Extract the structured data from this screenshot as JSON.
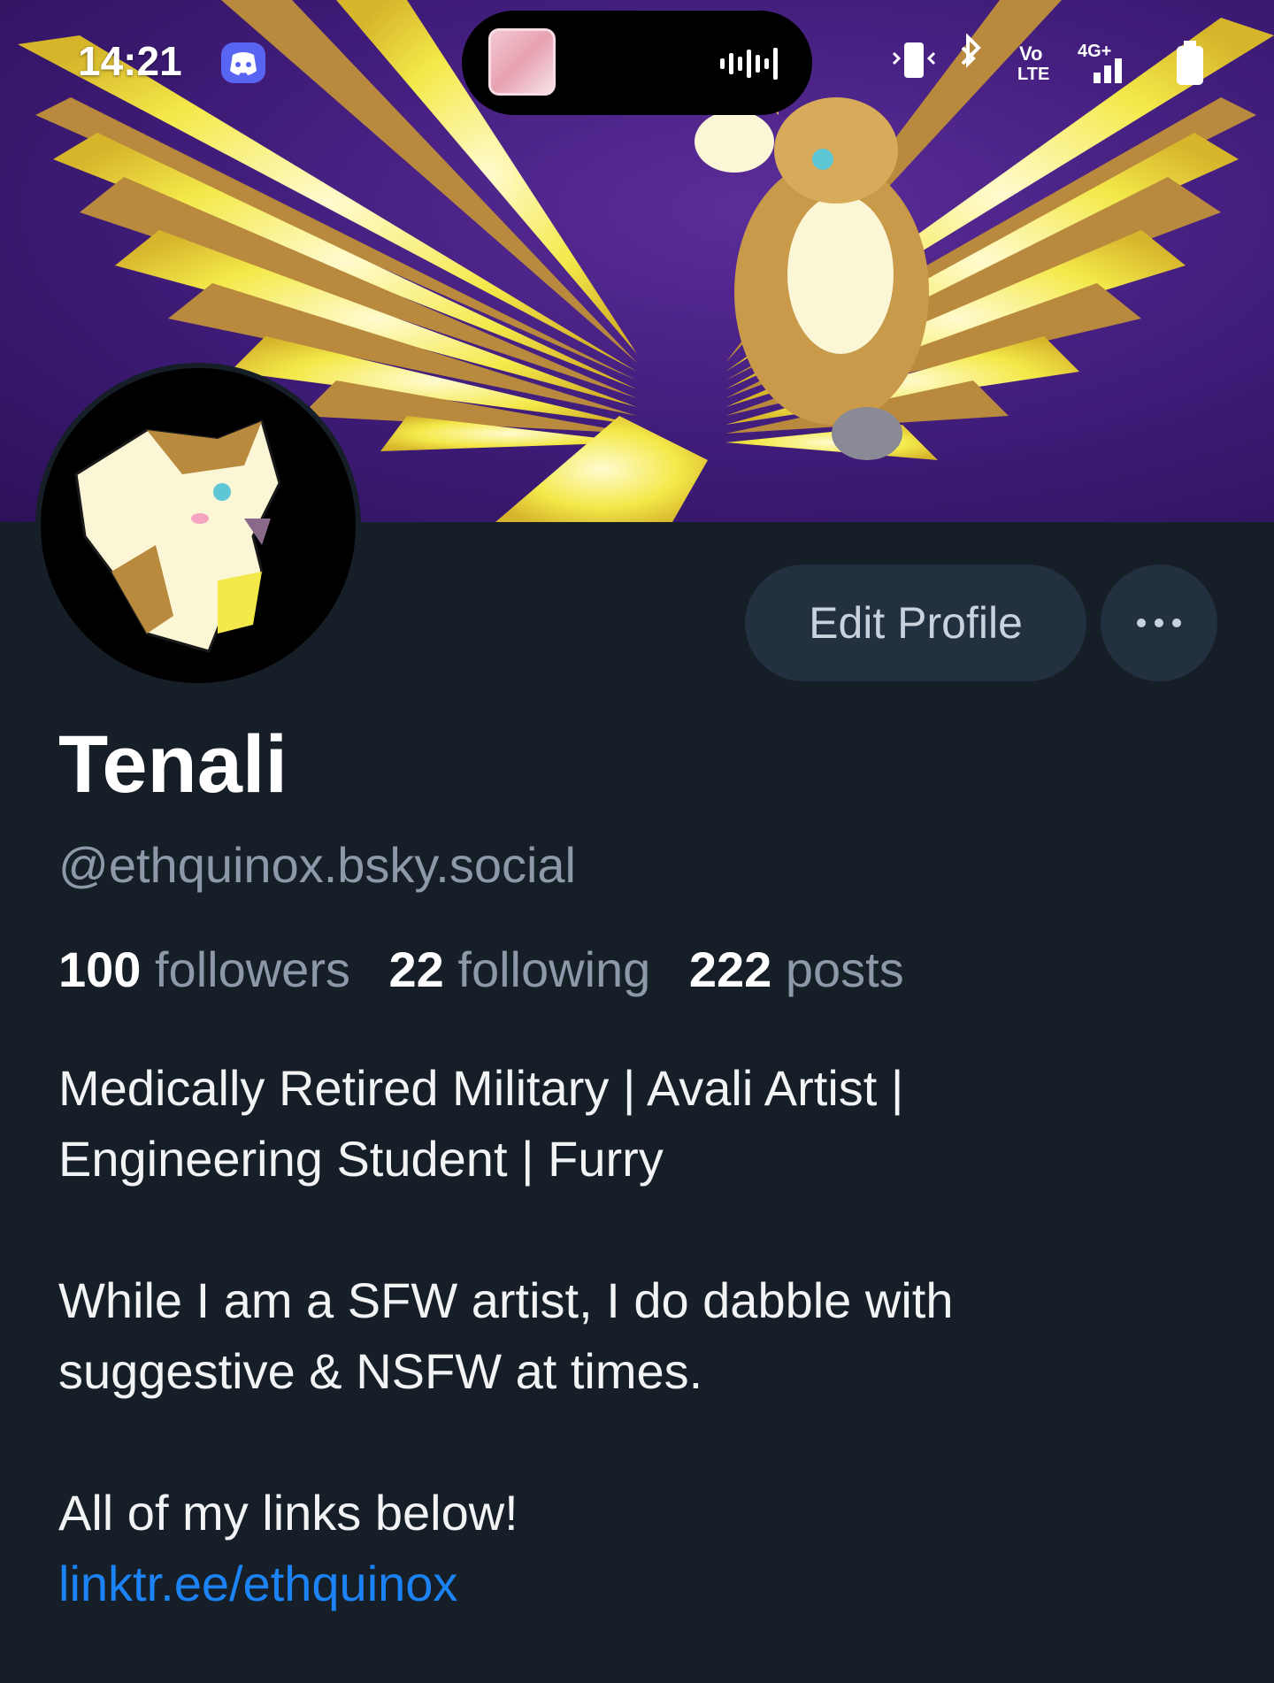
{
  "status_bar": {
    "time": "14:21",
    "network": "4G+",
    "volte": "Vo LTE"
  },
  "profile": {
    "display_name": "Tenali",
    "handle": "@ethquinox.bsky.social",
    "edit_button": "Edit Profile",
    "more_button": "more-options",
    "stats": {
      "followers_count": "100",
      "followers_label": "followers",
      "following_count": "22",
      "following_label": "following",
      "posts_count": "222",
      "posts_label": "posts"
    },
    "bio": {
      "line1": "Medically Retired Military | Avali Artist |",
      "line2": "Engineering Student | Furry",
      "line3": "While I am a SFW artist, I do dabble with",
      "line4": "suggestive & NSFW at times.",
      "line5": "All of my links below!",
      "link": "linktr.ee/ethquinox"
    }
  },
  "colors": {
    "background": "#161e27",
    "button_bg": "#233040",
    "muted_text": "#8d99a8",
    "link": "#1b83f5",
    "banner_purple": "#4a2288",
    "wing_yellow": "#f4e94a",
    "fur_brown": "#b98a3e"
  },
  "icons": [
    "discord-icon",
    "soundwave-icon",
    "vibrate-icon",
    "bluetooth-icon",
    "signal-icon",
    "battery-icon",
    "more-icon"
  ]
}
